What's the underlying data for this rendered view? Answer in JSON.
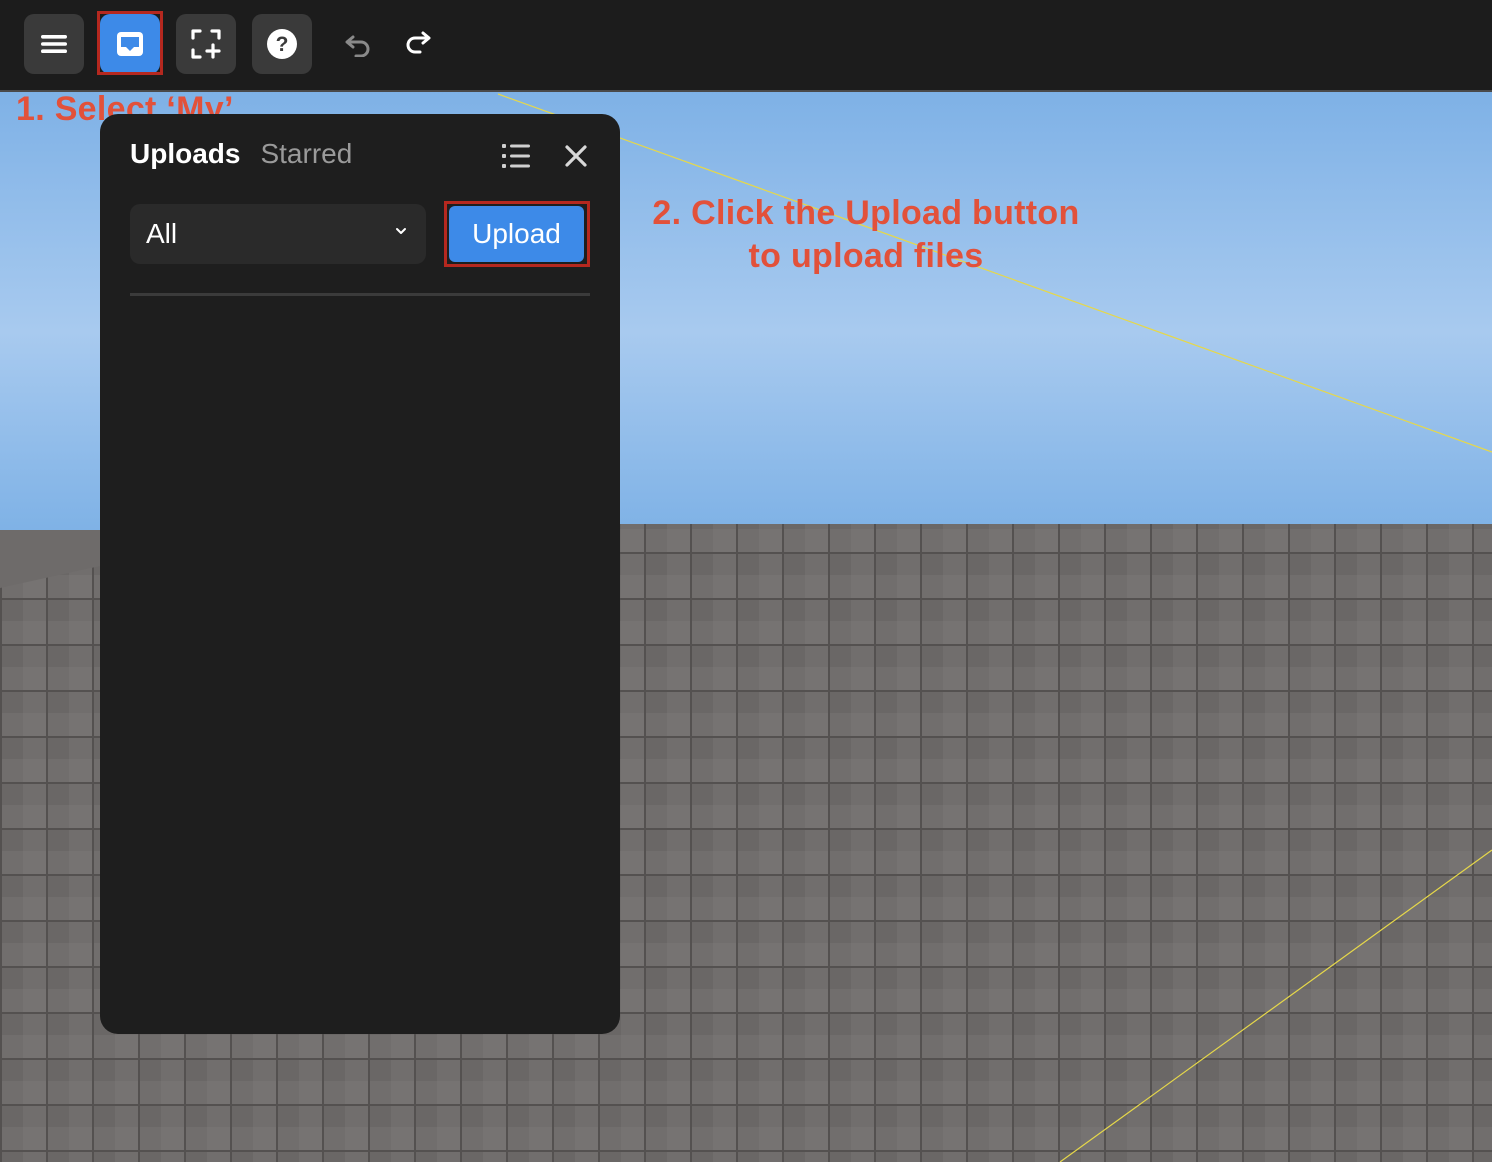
{
  "toolbar": {
    "buttons": [
      {
        "name": "menu",
        "icon": "hamburger-menu-icon"
      },
      {
        "name": "my",
        "icon": "inbox-tray-icon",
        "active": true
      },
      {
        "name": "add-frame",
        "icon": "frame-plus-icon"
      },
      {
        "name": "help",
        "icon": "question-mark-icon"
      },
      {
        "name": "undo",
        "icon": "undo-arrow-icon"
      },
      {
        "name": "redo",
        "icon": "redo-arrow-icon"
      }
    ]
  },
  "annotations": {
    "step1": "1. Select ‘My’",
    "step2_line1": "2. Click the Upload button",
    "step2_line2": "to upload files"
  },
  "panel": {
    "tabs": [
      {
        "label": "Uploads",
        "active": true
      },
      {
        "label": "Starred",
        "active": false
      }
    ],
    "filter": {
      "selected": "All"
    },
    "upload_label": "Upload",
    "icons": {
      "list": "list-view-icon",
      "close": "close-icon"
    }
  },
  "colors": {
    "accent": "#3d8ae8",
    "annotation": "#e2513a",
    "highlight": "#b5281f",
    "panel_bg": "#1e1e1e",
    "toolbar_bg": "#1c1c1c"
  }
}
